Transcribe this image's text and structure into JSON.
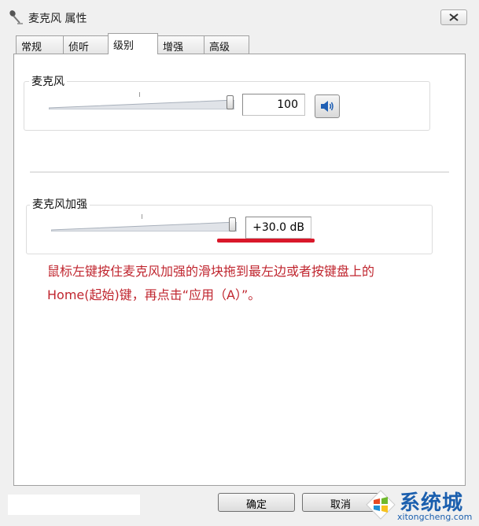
{
  "window": {
    "title": "麦克风 属性"
  },
  "tabs": [
    {
      "label": "常规",
      "active": false
    },
    {
      "label": "侦听",
      "active": false
    },
    {
      "label": "级别",
      "active": true
    },
    {
      "label": "增强",
      "active": false
    },
    {
      "label": "高级",
      "active": false
    }
  ],
  "microphone": {
    "label": "麦克风",
    "value": "100",
    "level": 1.0
  },
  "boost": {
    "label": "麦克风加强",
    "value": "+30.0 dB",
    "level": 1.0
  },
  "annotation": {
    "line1": "鼠标左键按住麦克风加强的滑块拖到最左边或者按键盘上的",
    "line2": "Home(起始)键，再点击“应用（A）”。",
    "color": "#c0262f"
  },
  "buttons": {
    "ok": "确定",
    "cancel": "取消"
  },
  "watermark": {
    "text": "系统城",
    "url": "xitongcheng.com"
  },
  "icons": {
    "app": "microphone-icon",
    "mute": "speaker-icon",
    "close": "close-icon",
    "logo": "windows-logo-icon"
  }
}
